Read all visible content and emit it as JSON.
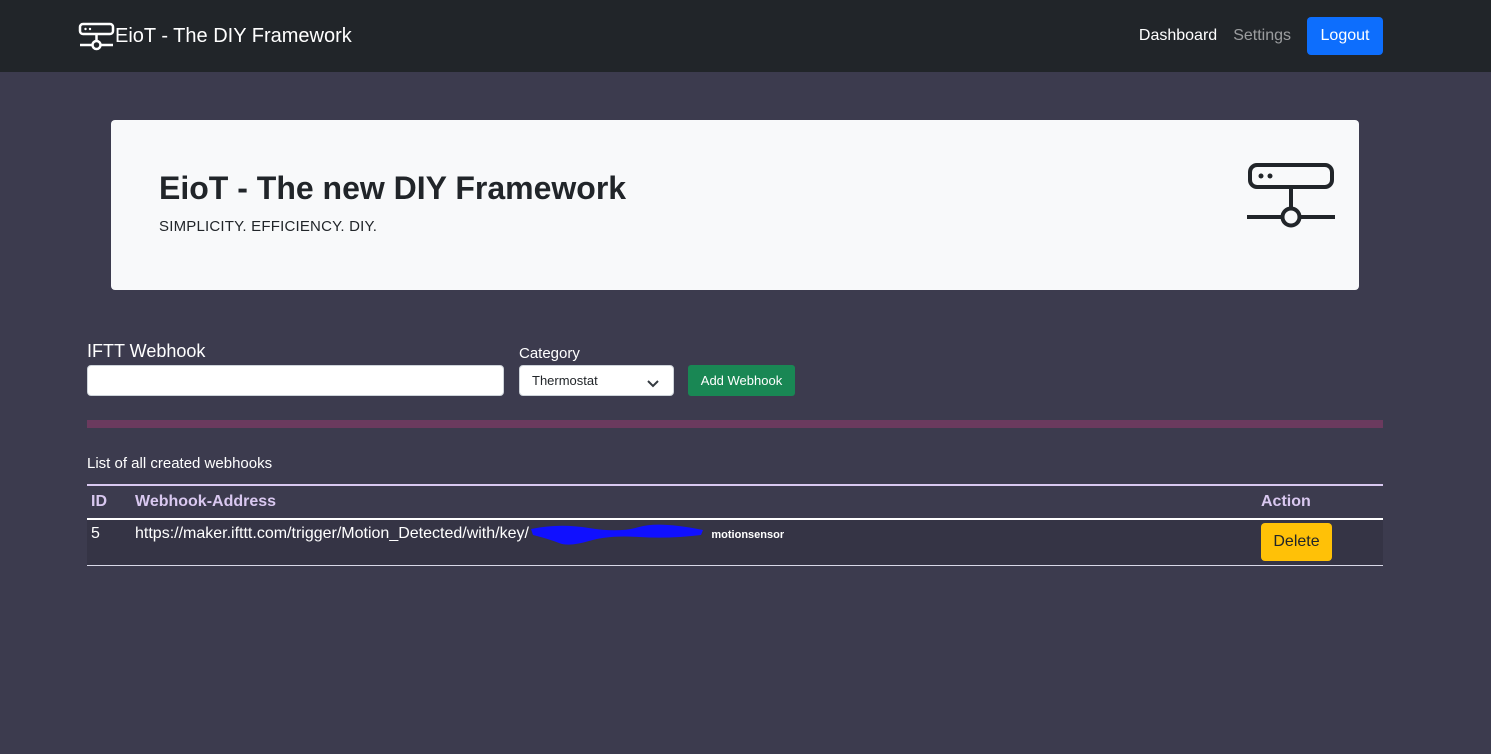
{
  "navbar": {
    "brand": "EioT - The DIY Framework",
    "links": {
      "dashboard": "Dashboard",
      "settings": "Settings"
    },
    "logout_label": "Logout"
  },
  "hero": {
    "title": "EioT - The new DIY Framework",
    "subtitle": "SIMPLICITY. EFFICIENCY. DIY."
  },
  "form": {
    "webhook_label": "IFTT Webhook",
    "webhook_value": "",
    "category_label": "Category",
    "category_selected": "Thermostat",
    "add_button": "Add Webhook"
  },
  "list": {
    "caption": "List of all created webhooks",
    "columns": {
      "id": "ID",
      "address": "Webhook-Address",
      "action": "Action"
    },
    "rows": [
      {
        "id": "5",
        "address": "https://maker.ifttt.com/trigger/Motion_Detected/with/key/",
        "category": "motionsensor",
        "action_label": "Delete"
      }
    ]
  },
  "colors": {
    "background": "#3c3b4e",
    "navbar": "#212529",
    "primary": "#0d6efd",
    "success": "#198754",
    "warning": "#ffc107",
    "header_text": "#d9c8f0",
    "divider": "#6b3a5e"
  }
}
